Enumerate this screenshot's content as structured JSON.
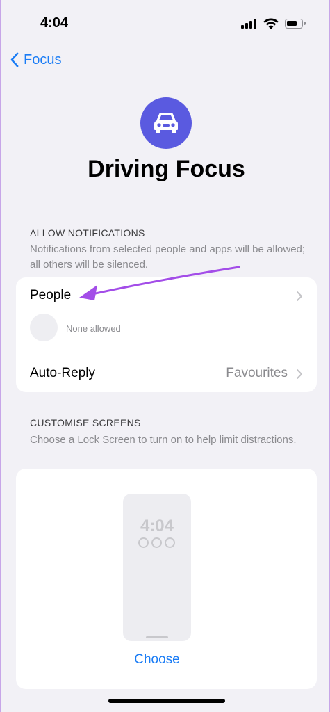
{
  "status_bar": {
    "time": "4:04",
    "icons": [
      "cellular-signal-icon",
      "wifi-icon",
      "battery-icon"
    ]
  },
  "nav": {
    "back_label": "Focus",
    "back_icon": "chevron-left-icon"
  },
  "header": {
    "icon": "car-icon",
    "icon_bg": "#5a5ae0",
    "title": "Driving Focus"
  },
  "allow_notifications": {
    "header": "ALLOW NOTIFICATIONS",
    "description": "Notifications from selected people and apps will be allowed; all others will be silenced.",
    "people": {
      "label": "People",
      "status": "None allowed"
    },
    "auto_reply": {
      "label": "Auto-Reply",
      "value": "Favourites"
    }
  },
  "customise_screens": {
    "header": "CUSTOMISE SCREENS",
    "description": "Choose a Lock Screen to turn on to help limit distractions.",
    "preview_time": "4:04",
    "choose_label": "Choose"
  },
  "colors": {
    "accent": "#1a7cf5",
    "annotation": "#a34de8",
    "background": "#f2f1f6"
  }
}
